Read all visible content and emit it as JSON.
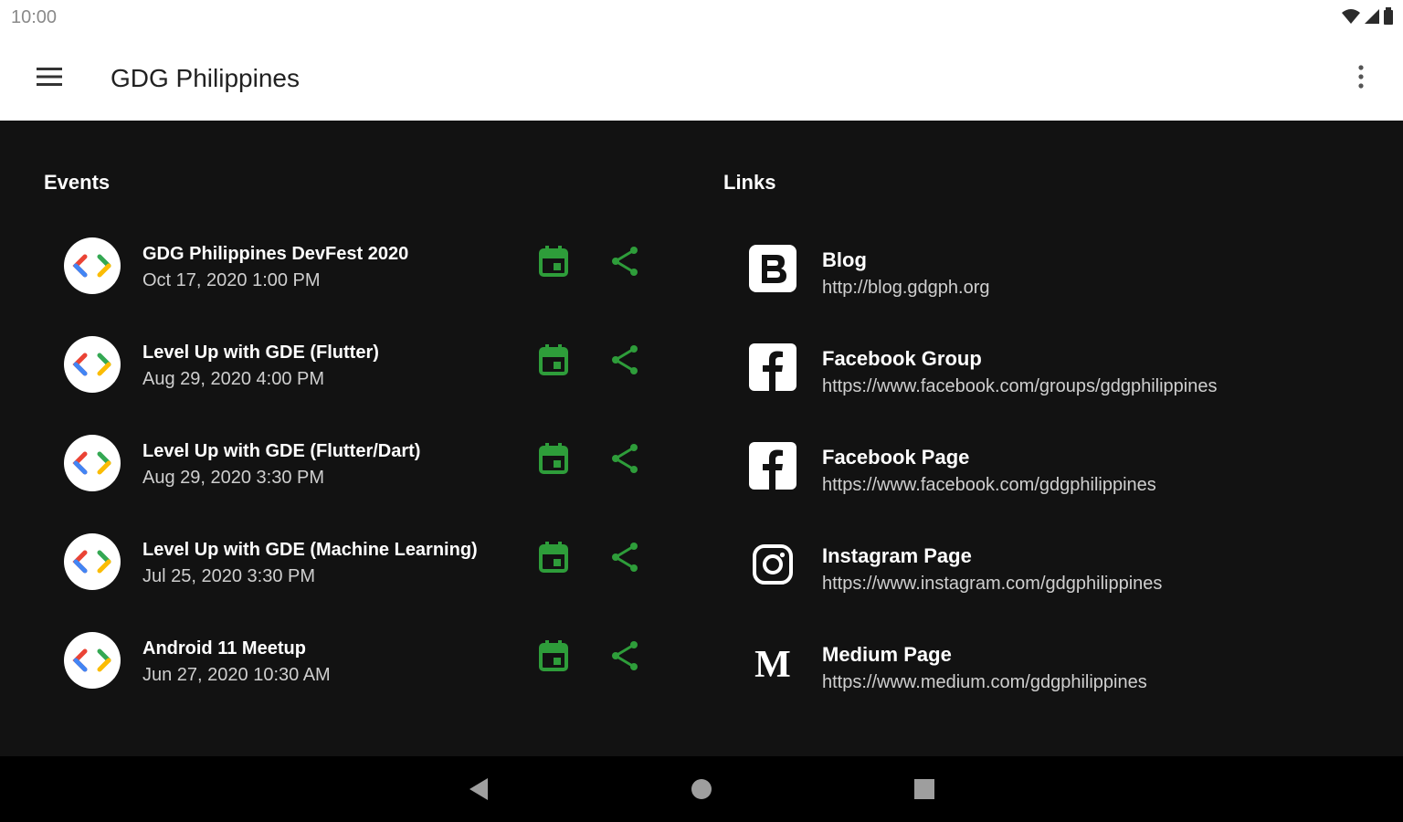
{
  "status_bar": {
    "time": "10:00"
  },
  "app_bar": {
    "title": "GDG Philippines"
  },
  "events": {
    "heading": "Events",
    "items": [
      {
        "name": "GDG Philippines DevFest 2020",
        "date": "Oct 17, 2020 1:00 PM"
      },
      {
        "name": "Level Up with GDE (Flutter)",
        "date": "Aug 29, 2020 4:00 PM"
      },
      {
        "name": "Level Up with GDE (Flutter/Dart)",
        "date": "Aug 29, 2020 3:30 PM"
      },
      {
        "name": "Level Up with GDE (Machine Learning)",
        "date": "Jul 25, 2020 3:30 PM"
      },
      {
        "name": "Android 11 Meetup",
        "date": "Jun 27, 2020 10:30 AM"
      }
    ]
  },
  "links": {
    "heading": "Links",
    "items": [
      {
        "name": "Blog",
        "url": "http://blog.gdgph.org",
        "icon": "blogger-icon"
      },
      {
        "name": "Facebook Group",
        "url": "https://www.facebook.com/groups/gdgphilippines",
        "icon": "facebook-icon"
      },
      {
        "name": "Facebook Page",
        "url": "https://www.facebook.com/gdgphilippines",
        "icon": "facebook-icon"
      },
      {
        "name": "Instagram Page",
        "url": "https://www.instagram.com/gdgphilippines",
        "icon": "instagram-icon"
      },
      {
        "name": "Medium Page",
        "url": "https://www.medium.com/gdgphilippines",
        "icon": "medium-icon"
      }
    ]
  },
  "colors": {
    "accent": "#2e9d3a",
    "background": "#121212",
    "app_bar": "#ffffff"
  }
}
